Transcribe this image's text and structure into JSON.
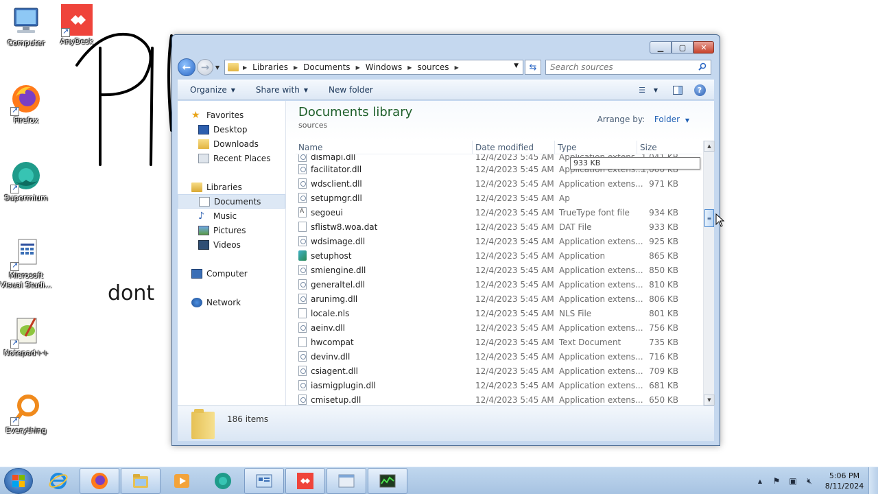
{
  "desktop": {
    "icons": [
      {
        "label": "Computer"
      },
      {
        "label": "AnyDesk"
      },
      {
        "label": "Firefox"
      },
      {
        "label": "Supermium"
      },
      {
        "label": "Microsoft Visual Studi..."
      },
      {
        "label": "Notepad++"
      },
      {
        "label": "Everything"
      }
    ],
    "scribble_text": "dont"
  },
  "window": {
    "nav": {
      "back": "back",
      "forward": "forward"
    },
    "breadcrumb": [
      "Libraries",
      "Documents",
      "Windows",
      "sources"
    ],
    "search": {
      "placeholder": "Search sources"
    },
    "toolbar": {
      "organize": "Organize",
      "share_with": "Share with",
      "new_folder": "New folder"
    },
    "nav_pane": {
      "favorites": "Favorites",
      "desktop": "Desktop",
      "downloads": "Downloads",
      "recent_places": "Recent Places",
      "libraries": "Libraries",
      "documents": "Documents",
      "music": "Music",
      "pictures": "Pictures",
      "videos": "Videos",
      "computer": "Computer",
      "network": "Network"
    },
    "library": {
      "title": "Documents library",
      "subtitle": "sources",
      "arrange_label": "Arrange by:",
      "arrange_value": "Folder"
    },
    "columns": {
      "name": "Name",
      "date": "Date modified",
      "type": "Type",
      "size": "Size"
    },
    "partial_row": {
      "name": "dismapi.dll",
      "date": "12/4/2023 5:45 AM",
      "type": "Application extens...",
      "size": "1,041 KB"
    },
    "files": [
      {
        "name": "facilitator.dll",
        "date": "12/4/2023 5:45 AM",
        "type": "Application extens...",
        "size": "1,000 KB",
        "icon": "dll"
      },
      {
        "name": "wdsclient.dll",
        "date": "12/4/2023 5:45 AM",
        "type": "Application extens...",
        "size": "971 KB",
        "icon": "dll"
      },
      {
        "name": "setupmgr.dll",
        "date": "12/4/2023 5:45 AM",
        "type": "Ap",
        "size": "",
        "icon": "dll"
      },
      {
        "name": "segoeui",
        "date": "12/4/2023 5:45 AM",
        "type": "TrueType font file",
        "size": "934 KB",
        "icon": "font"
      },
      {
        "name": "sflistw8.woa.dat",
        "date": "12/4/2023 5:45 AM",
        "type": "DAT File",
        "size": "933 KB",
        "icon": "file"
      },
      {
        "name": "wdsimage.dll",
        "date": "12/4/2023 5:45 AM",
        "type": "Application extens...",
        "size": "925 KB",
        "icon": "dll"
      },
      {
        "name": "setuphost",
        "date": "12/4/2023 5:45 AM",
        "type": "Application",
        "size": "865 KB",
        "icon": "app"
      },
      {
        "name": "smiengine.dll",
        "date": "12/4/2023 5:45 AM",
        "type": "Application extens...",
        "size": "850 KB",
        "icon": "dll"
      },
      {
        "name": "generaltel.dll",
        "date": "12/4/2023 5:45 AM",
        "type": "Application extens...",
        "size": "810 KB",
        "icon": "dll"
      },
      {
        "name": "arunimg.dll",
        "date": "12/4/2023 5:45 AM",
        "type": "Application extens...",
        "size": "806 KB",
        "icon": "dll"
      },
      {
        "name": "locale.nls",
        "date": "12/4/2023 5:45 AM",
        "type": "NLS File",
        "size": "801 KB",
        "icon": "file"
      },
      {
        "name": "aeinv.dll",
        "date": "12/4/2023 5:45 AM",
        "type": "Application extens...",
        "size": "756 KB",
        "icon": "dll"
      },
      {
        "name": "hwcompat",
        "date": "12/4/2023 5:45 AM",
        "type": "Text Document",
        "size": "735 KB",
        "icon": "file"
      },
      {
        "name": "devinv.dll",
        "date": "12/4/2023 5:45 AM",
        "type": "Application extens...",
        "size": "716 KB",
        "icon": "dll"
      },
      {
        "name": "csiagent.dll",
        "date": "12/4/2023 5:45 AM",
        "type": "Application extens...",
        "size": "709 KB",
        "icon": "dll"
      },
      {
        "name": "iasmigplugin.dll",
        "date": "12/4/2023 5:45 AM",
        "type": "Application extens...",
        "size": "681 KB",
        "icon": "dll"
      },
      {
        "name": "cmisetup.dll",
        "date": "12/4/2023 5:45 AM",
        "type": "Application extens...",
        "size": "650 KB",
        "icon": "dll"
      }
    ],
    "tooltip": "933 KB",
    "status": {
      "items": "186 items"
    }
  },
  "taskbar": {
    "clock_time": "5:06 PM",
    "clock_date": "8/11/2024"
  },
  "colors": {
    "library_title": "#1e5f2a",
    "link_blue": "#1e5fb4",
    "anydesk_red": "#ef443b"
  }
}
